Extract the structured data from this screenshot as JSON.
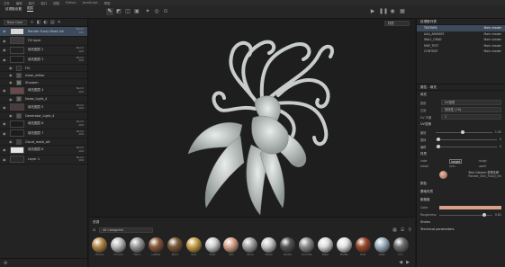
{
  "menubar": [
    "文件",
    "编辑",
    "模式",
    "窗口",
    "视图",
    "Python",
    "JavaScript",
    "帮助"
  ],
  "left_panel": {
    "tabs": [
      "纹理集设置",
      "图层"
    ],
    "active_tab": 1,
    "blend_select": "Base Color",
    "layers": [
      {
        "name": "Render Fuzzy Mask Ink",
        "thumb": "#d8d8d8",
        "blend": "Norm",
        "opacity": "100",
        "selected": true,
        "sub": false
      },
      {
        "name": "Fill layer",
        "thumb": "#3a3a3a",
        "blend": "",
        "opacity": "",
        "selected": false,
        "sub": false
      },
      {
        "name": "填充图层 2",
        "thumb": "#222",
        "blend": "Norm",
        "opacity": "100",
        "selected": false,
        "sub": false
      },
      {
        "name": "填充图层 3",
        "thumb": "#1d1d1d",
        "blend": "Norm",
        "opacity": "100",
        "selected": false,
        "sub": false
      },
      {
        "name": "Fill",
        "thumb": "#2e2e2e",
        "blend": "",
        "opacity": "",
        "selected": false,
        "sub": true
      },
      {
        "name": "mask_editor",
        "thumb": "#555",
        "blend": "",
        "opacity": "",
        "selected": false,
        "sub": true
      },
      {
        "name": "Sharpen",
        "thumb": "#777",
        "blend": "",
        "opacity": "",
        "selected": false,
        "sub": true
      },
      {
        "name": "填充图层 4",
        "thumb": "#6a4a4a",
        "blend": "Norm",
        "opacity": "100",
        "selected": false,
        "sub": false
      },
      {
        "name": "Noise_Light_4",
        "thumb": "#666",
        "blend": "",
        "opacity": "",
        "selected": false,
        "sub": true
      },
      {
        "name": "填充图层 5",
        "thumb": "#4d3a3a",
        "blend": "Norm",
        "opacity": "100",
        "selected": false,
        "sub": false
      },
      {
        "name": "Generator_Light_4",
        "thumb": "#555",
        "blend": "",
        "opacity": "",
        "selected": false,
        "sub": true
      },
      {
        "name": "填充图层 6",
        "thumb": "#1c1c1c",
        "blend": "Norm",
        "opacity": "100",
        "selected": false,
        "sub": false
      },
      {
        "name": "填充图层 7",
        "thumb": "#1c1c1c",
        "blend": "Norm",
        "opacity": "100",
        "selected": false,
        "sub": false
      },
      {
        "name": "Cloud_mask_alt",
        "thumb": "#444",
        "blend": "",
        "opacity": "",
        "selected": false,
        "sub": true
      },
      {
        "name": "填充图层 8",
        "thumb": "#e6e6e6",
        "blend": "Norm",
        "opacity": "100",
        "selected": false,
        "sub": false
      },
      {
        "name": "Layer 1",
        "thumb": "#2a2a2a",
        "blend": "Norm",
        "opacity": "100",
        "selected": false,
        "sub": false
      }
    ]
  },
  "viewport": {
    "material_select": "材质"
  },
  "shelf": {
    "title": "资源",
    "search_placeholder": "All Categories",
    "materials": [
      {
        "name": "Bronze",
        "color": "#b58a4a"
      },
      {
        "name": "Chrome",
        "color": "#bcbcbc"
      },
      {
        "name": "Fabric",
        "color": "#9b9b9b"
      },
      {
        "name": "Leather",
        "color": "#8a5a3c"
      },
      {
        "name": "Wood",
        "color": "#7a5a38"
      },
      {
        "name": "Gold",
        "color": "#c9a24a"
      },
      {
        "name": "Silver",
        "color": "#cfcfcf"
      },
      {
        "name": "Skin",
        "color": "#d9a58b"
      },
      {
        "name": "Stone",
        "color": "#a5a5a5"
      },
      {
        "name": "Plastic",
        "color": "#c8c8c8"
      },
      {
        "name": "Rubber",
        "color": "#555555"
      },
      {
        "name": "Concrete",
        "color": "#8c8c8c"
      },
      {
        "name": "Paper",
        "color": "#dcdcdc"
      },
      {
        "name": "Marble",
        "color": "#e2e2e2"
      },
      {
        "name": "Rust",
        "color": "#9a4a2e"
      },
      {
        "name": "Glass",
        "color": "#9fb2c0"
      },
      {
        "name": "Iron",
        "color": "#6e6e6e"
      }
    ]
  },
  "right_panel": {
    "texture_title": "纹理集列表",
    "texture_sets": [
      {
        "name": "TEXTURE",
        "shader": "Main shader",
        "selected": true
      },
      {
        "name": "AAA_ANIMATE",
        "shader": "Main shader",
        "selected": false
      },
      {
        "name": "WALL_GRAD",
        "shader": "Main shader",
        "selected": false
      },
      {
        "name": "MAP_TEST",
        "shader": "Main shader",
        "selected": false
      },
      {
        "name": "CONTENT",
        "shader": "Main shader",
        "selected": false
      }
    ],
    "props_title": "属性 - 填充",
    "props": {
      "fill_label": "填充",
      "projection_label": "投射",
      "projection_value": "UV投射",
      "filter_label": "过滤",
      "filter_value": "双线性 | HQ",
      "tiling_label": "UV 平铺",
      "tiling_value": "1",
      "uv_label": "UV变换",
      "scale_label": "缩放",
      "scale_value": "1.00",
      "rotation_label": "旋转",
      "rotation_value": "0",
      "offset_label": "偏移",
      "offset_value": "0",
      "material_label": "材质",
      "channels": [
        "color",
        "height",
        "rough",
        "metal",
        "nrm",
        "user0"
      ],
      "material_name": "Skin Column 材质名称",
      "material_sub": "Render_Skin_Fuzzy_Ink",
      "section_color": "颜色",
      "section_base": "基础材质",
      "section_roughness": "粗糙度",
      "color_label": "Color",
      "roughness_label": "Roughness",
      "roughness_value": "0.82",
      "section_sheen": "Sheen",
      "section_technical": "Technical parameters"
    }
  },
  "colors": {
    "accent": "#3d4a5c",
    "panel": "#232323",
    "viewport": "#1e1e1e",
    "swatch": "#d9a08a"
  }
}
